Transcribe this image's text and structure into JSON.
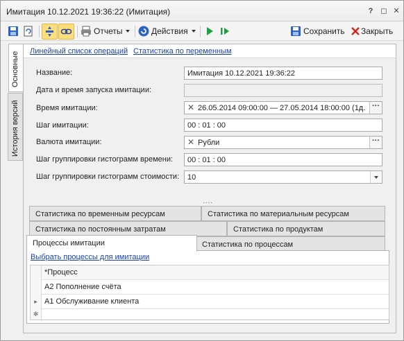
{
  "window": {
    "title": "Имитация 10.12.2021 19:36:22 (Имитация)",
    "help": "?",
    "restore": "◻",
    "close": "✕"
  },
  "toolbar": {
    "reports_label": "Отчеты",
    "actions_label": "Действия",
    "save_label": "Сохранить",
    "close_label": "Закрыть"
  },
  "side_tabs": {
    "main": "Основные",
    "history": "История версий"
  },
  "links": {
    "ops": "Линейный список операций",
    "stats": "Статистика по переменным"
  },
  "form": {
    "name_label": "Название:",
    "name_value": "Имитация 10.12.2021 19:36:22",
    "start_label": "Дата и время запуска имитации:",
    "start_value": "",
    "time_label": "Время имитации:",
    "time_value": "26.05.2014 09:00:00 — 27.05.2014 18:00:00 (1д.",
    "step_label": "Шаг имитации:",
    "step_value": "00 : 01 : 00",
    "currency_label": "Валюта имитации:",
    "currency_value": "Рубли",
    "hist_time_label": "Шаг группировки гистограмм времени:",
    "hist_time_value": "00 : 01 : 00",
    "hist_cost_label": "Шаг группировки гистограмм стоимости:",
    "hist_cost_value": "10"
  },
  "splitter_grip": "....",
  "stat_tabs": {
    "time_resources": "Статистика по временным ресурсам",
    "material_resources": "Статистика по материальным ресурсам",
    "fixed_costs": "Статистика по постоянным затратам",
    "products": "Статистика по продуктам",
    "processes_sim": "Процессы имитации",
    "processes_stats": "Статистика по процессам"
  },
  "panel": {
    "select_link": "Выбрать процессы для имитации",
    "column_header": "*Процесс",
    "rows": [
      {
        "name": "А2 Пополнение счёта"
      },
      {
        "name": "А1 Обслуживание клиента"
      }
    ],
    "current_row_marker": "▸",
    "new_row_marker": "✻"
  },
  "colors": {
    "link": "#1a42b5",
    "active_toggle": "#fdde7c",
    "save_icon": "#2a62c8",
    "close_icon": "#d8251c",
    "play_icon": "#1fa040"
  }
}
